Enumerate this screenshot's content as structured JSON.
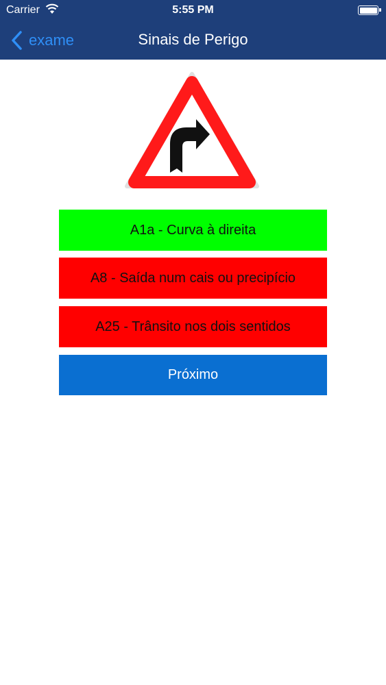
{
  "status_bar": {
    "carrier": "Carrier",
    "time": "5:55 PM",
    "wifi_icon": "wifi-icon",
    "battery_icon": "battery-icon"
  },
  "nav": {
    "back_label": "exame",
    "back_icon": "chevron-left-icon",
    "title": "Sinais de Perigo"
  },
  "sign": {
    "icon": "right-curve-warning-sign"
  },
  "answers": [
    {
      "label": "A1a - Curva à direita",
      "state": "correct"
    },
    {
      "label": "A8 - Saída num cais ou precipício",
      "state": "wrong"
    },
    {
      "label": "A25 - Trânsito nos dois sentidos",
      "state": "wrong"
    }
  ],
  "next_label": "Próximo",
  "colors": {
    "bar": "#1e3f7a",
    "back_link": "#2f8ff7",
    "correct": "#00ff00",
    "wrong": "#ff0000",
    "next": "#0a6fd1"
  }
}
